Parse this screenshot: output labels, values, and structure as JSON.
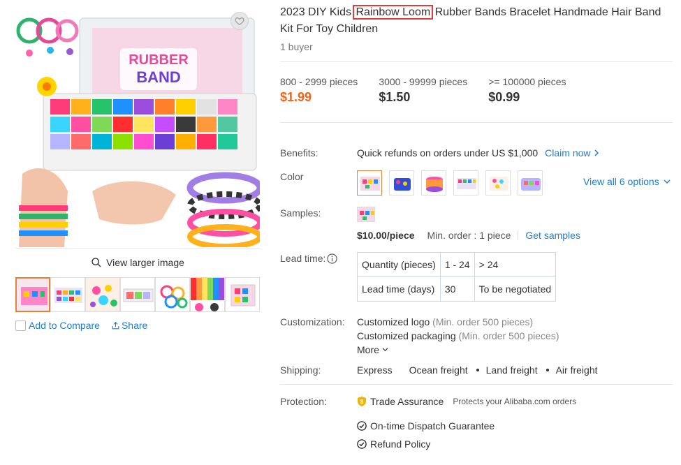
{
  "product": {
    "title_before": "2023 DIY Kids ",
    "title_highlight": "Rainbow Loom",
    "title_after": " Rubber Bands Bracelet Handmade Hair Band Kit For Toy Children",
    "buyers": "1 buyer",
    "box_label_line1": "RUBBER",
    "box_label_line2": "BAND"
  },
  "gallery": {
    "view_larger": "View larger image",
    "add_to_compare": "Add to Compare",
    "share": "Share",
    "thumbnail_count": 7
  },
  "price_tiers": [
    {
      "qty": "800 - 2999 pieces",
      "price": "$1.99"
    },
    {
      "qty": "3000 - 99999 pieces",
      "price": "$1.50"
    },
    {
      "qty": ">= 100000 pieces",
      "price": "$0.99"
    }
  ],
  "benefits": {
    "label": "Benefits:",
    "text": "Quick refunds on orders under US $1,000",
    "link": "Claim now"
  },
  "color": {
    "label": "Color",
    "view_all": "View all 6 options"
  },
  "samples": {
    "label": "Samples:",
    "price": "$10.00/piece",
    "min_order": "Min. order : 1 piece",
    "link": "Get samples"
  },
  "lead_time": {
    "label": "Lead time:",
    "rows": [
      [
        "Quantity (pieces)",
        "1 - 24",
        "> 24"
      ],
      [
        "Lead time (days)",
        "30",
        "To be negotiated"
      ]
    ]
  },
  "customization": {
    "label": "Customization:",
    "items": [
      {
        "name": "Customized logo",
        "note": "(Min. order 500 pieces)"
      },
      {
        "name": "Customized packaging",
        "note": "(Min. order 500 pieces)"
      }
    ],
    "more": "More"
  },
  "shipping": {
    "label": "Shipping:",
    "methods": [
      "Express",
      "Ocean freight",
      "Land freight",
      "Air freight"
    ]
  },
  "protection": {
    "label": "Protection:",
    "trade_assurance": "Trade Assurance",
    "trade_note": "Protects your Alibaba.com orders",
    "dispatch": "On-time Dispatch Guarantee",
    "refund": "Refund Policy"
  },
  "colors": {
    "link": "#1f7ccf",
    "price_accent": "#f06418",
    "highlight_box": "#e03a3a",
    "active_border": "#e2853a"
  }
}
